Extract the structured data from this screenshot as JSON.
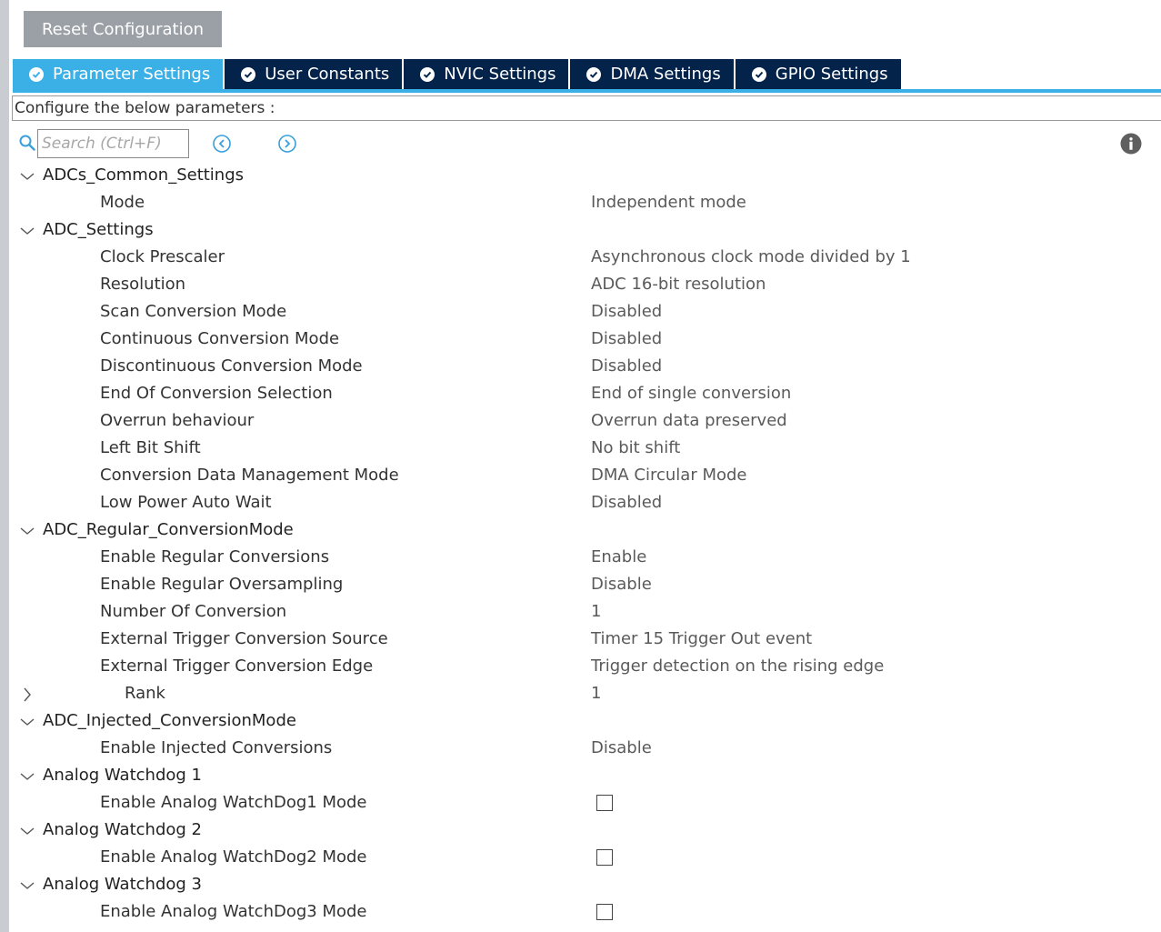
{
  "toolbar": {
    "reset_label": "Reset Configuration"
  },
  "tabs": [
    {
      "label": "Parameter Settings",
      "active": true
    },
    {
      "label": "User Constants",
      "active": false
    },
    {
      "label": "NVIC Settings",
      "active": false
    },
    {
      "label": "DMA Settings",
      "active": false
    },
    {
      "label": "GPIO Settings",
      "active": false
    }
  ],
  "instructions": "Configure the below parameters :",
  "search": {
    "placeholder": "Search (Ctrl+F)",
    "value": ""
  },
  "groups": [
    {
      "name": "ADCs_Common_Settings",
      "params": [
        {
          "label": "Mode",
          "value": "Independent mode"
        }
      ]
    },
    {
      "name": "ADC_Settings",
      "params": [
        {
          "label": "Clock Prescaler",
          "value": "Asynchronous clock mode divided by 1"
        },
        {
          "label": "Resolution",
          "value": "ADC 16-bit resolution"
        },
        {
          "label": "Scan Conversion Mode",
          "value": "Disabled"
        },
        {
          "label": "Continuous Conversion Mode",
          "value": "Disabled"
        },
        {
          "label": "Discontinuous Conversion Mode",
          "value": "Disabled"
        },
        {
          "label": "End Of Conversion Selection",
          "value": "End of single conversion"
        },
        {
          "label": "Overrun behaviour",
          "value": "Overrun data preserved"
        },
        {
          "label": "Left Bit Shift",
          "value": "No bit shift"
        },
        {
          "label": "Conversion Data Management Mode",
          "value": "DMA Circular Mode"
        },
        {
          "label": "Low Power Auto Wait",
          "value": "Disabled"
        }
      ]
    },
    {
      "name": "ADC_Regular_ConversionMode",
      "params": [
        {
          "label": "Enable Regular Conversions",
          "value": "Enable"
        },
        {
          "label": "Enable Regular Oversampling",
          "value": "Disable"
        },
        {
          "label": "Number Of Conversion",
          "value": "1"
        },
        {
          "label": "External Trigger Conversion Source",
          "value": "Timer 15 Trigger Out event"
        },
        {
          "label": "External Trigger Conversion Edge",
          "value": "Trigger detection on the rising edge"
        },
        {
          "label": "Rank",
          "value": "1"
        }
      ]
    },
    {
      "name": "ADC_Injected_ConversionMode",
      "params": [
        {
          "label": "Enable Injected Conversions",
          "value": "Disable"
        }
      ]
    },
    {
      "name": "Analog Watchdog 1",
      "params": [
        {
          "label": "Enable Analog WatchDog1 Mode",
          "checked": false
        }
      ]
    },
    {
      "name": "Analog Watchdog 2",
      "params": [
        {
          "label": "Enable Analog WatchDog2 Mode",
          "checked": false
        }
      ]
    },
    {
      "name": "Analog Watchdog 3",
      "params": [
        {
          "label": "Enable Analog WatchDog3 Mode",
          "checked": false
        }
      ]
    }
  ],
  "colors": {
    "tab_active": "#3bb0e6",
    "tab_inactive": "#03234b",
    "reset_button": "#9aa0a6",
    "search_icon": "#3aa0dc"
  }
}
